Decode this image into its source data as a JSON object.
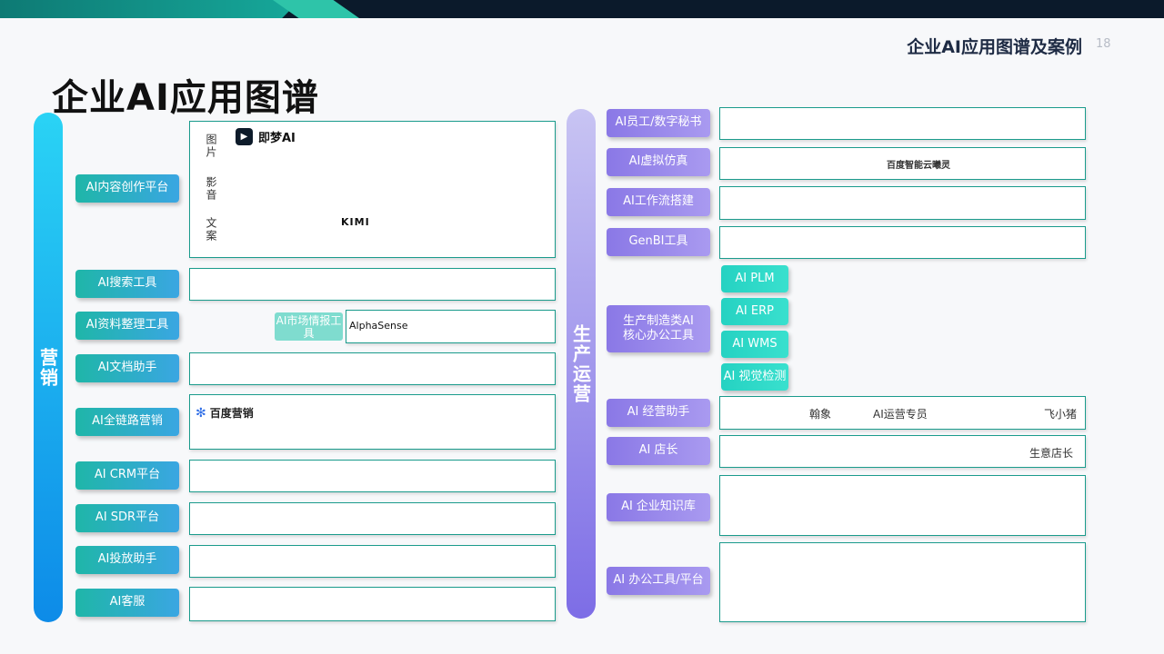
{
  "header": {
    "section_title": "企业AI应用图谱及案例",
    "page_number": "18",
    "title": "企业AI应用图谱"
  },
  "marketing": {
    "label": "营销",
    "categories": [
      "AI内容创作平台",
      "AI搜索工具",
      "AI资料整理工具",
      "AI文档助手",
      "AI全链路营销",
      "AI CRM平台",
      "AI SDR平台",
      "AI投放助手",
      "AI客服"
    ],
    "content_types": [
      "图片",
      "影音",
      "文案"
    ],
    "logos": {
      "jimeng": "即梦AI",
      "kimi": "KIMI",
      "baidu_marketing": "百度营销",
      "alphasense": "AlphaSense"
    },
    "market_intel_tag": "AI市场情报工具"
  },
  "operations": {
    "label": "生产运营",
    "categories": [
      "AI员工/数字秘书",
      "AI虚拟仿真",
      "AI工作流搭建",
      "GenBI工具",
      "生产制造类AI核心办公工具",
      "AI 经营助手",
      "AI 店长",
      "AI 企业知识库",
      "AI 办公工具/平台"
    ],
    "manufacturing_tools": [
      "AI PLM",
      "AI ERP",
      "AI WMS",
      "AI 视觉检测"
    ],
    "logos": {
      "baidu_ai_cloud": "百度智能云曦灵"
    },
    "assistant_examples": [
      "翰象",
      "AI运营专员",
      "飞小猪"
    ],
    "store_example": "生意店长"
  }
}
